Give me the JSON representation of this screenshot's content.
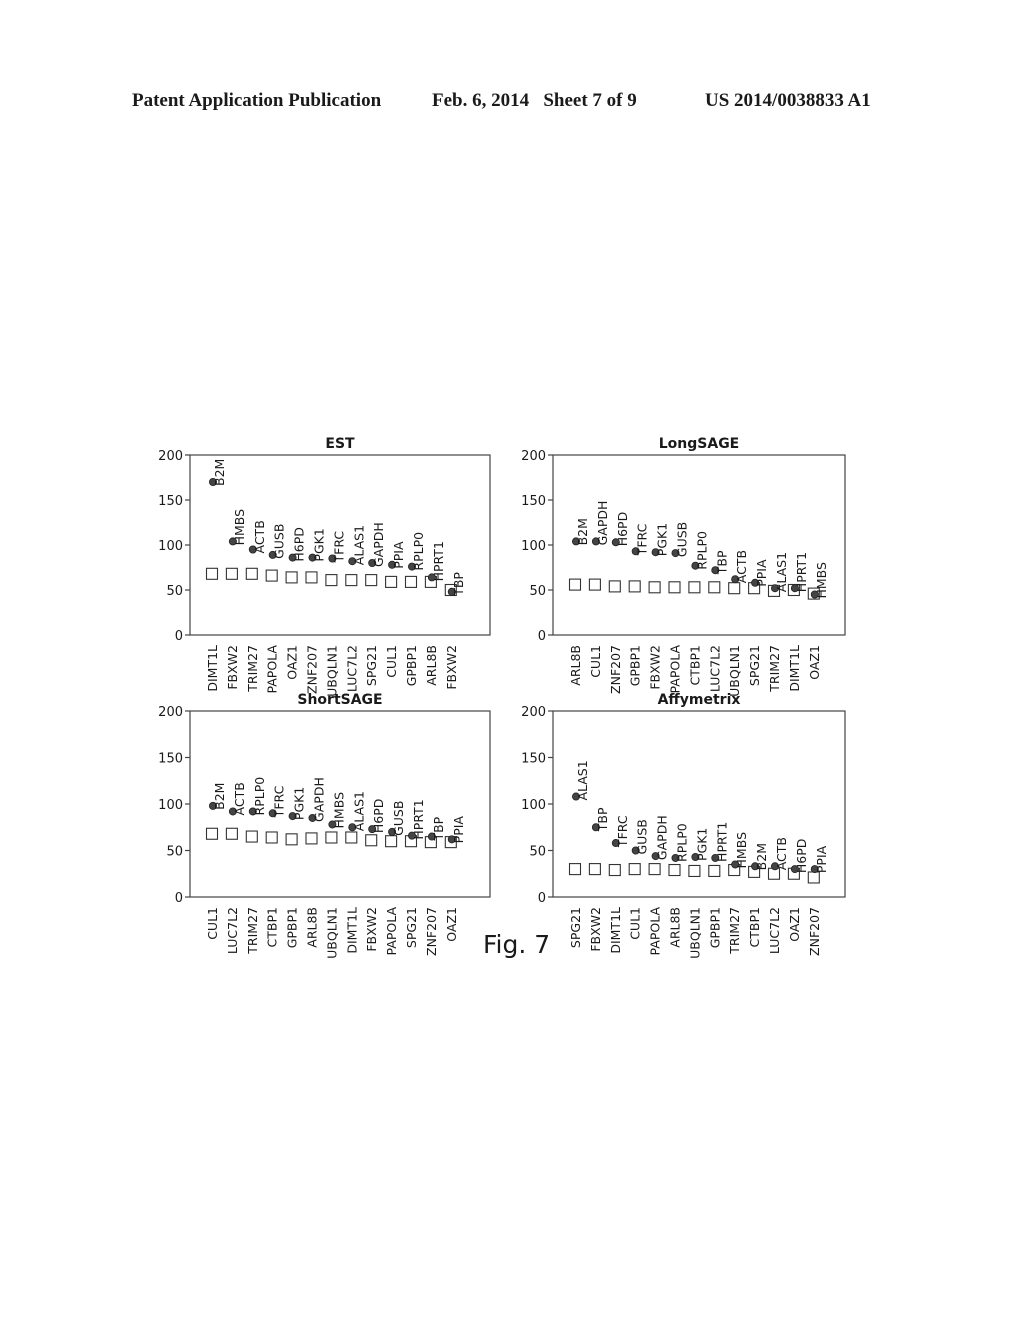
{
  "header": {
    "left": "Patent Application Publication",
    "middle": "Feb. 6, 2014   Sheet 7 of 9",
    "right": "US 2014/0038833 A1"
  },
  "figure_label": "Fig. 7",
  "chart_data": [
    {
      "type": "scatter",
      "title": "EST",
      "ylim": [
        0,
        200
      ],
      "yticks": [
        0,
        50,
        100,
        150,
        200
      ],
      "categories": [
        "DIMT1L",
        "FBXW2",
        "TRIM27",
        "PAPOLA",
        "OAZ1",
        "ZNF207",
        "UBQLN1",
        "LUC7L2",
        "SPG21",
        "CUL1",
        "GPBP1",
        "ARL8B",
        "FBXW2"
      ],
      "series": [
        {
          "name": "open-square",
          "values": [
            68,
            68,
            68,
            66,
            64,
            64,
            61,
            61,
            61,
            59,
            59,
            59,
            50
          ]
        },
        {
          "name": "filled-circle",
          "labels": [
            "B2M",
            "HMBS",
            "ACTB",
            "GUSB",
            "H6PD",
            "PGK1",
            "TFRC",
            "ALAS1",
            "GAPDH",
            "PPIA",
            "RPLP0",
            "HPRT1",
            "TBP"
          ],
          "values": [
            170,
            104,
            95,
            89,
            86,
            86,
            85,
            82,
            80,
            78,
            76,
            64,
            48
          ]
        }
      ]
    },
    {
      "type": "scatter",
      "title": "LongSAGE",
      "ylim": [
        0,
        200
      ],
      "yticks": [
        0,
        50,
        100,
        150,
        200
      ],
      "categories": [
        "ARL8B",
        "CUL1",
        "ZNF207",
        "GPBP1",
        "FBXW2",
        "PAPOLA",
        "CTBP1",
        "LUC7L2",
        "UBQLN1",
        "SPG21",
        "TRIM27",
        "DIMT1L",
        "OAZ1"
      ],
      "series": [
        {
          "name": "open-square",
          "values": [
            56,
            56,
            54,
            54,
            53,
            53,
            53,
            53,
            52,
            52,
            49,
            50,
            46
          ]
        },
        {
          "name": "filled-circle",
          "labels": [
            "B2M",
            "GAPDH",
            "H6PD",
            "TFRC",
            "PGK1",
            "GUSB",
            "RPLP0",
            "TBP",
            "ACTB",
            "PPIA",
            "ALAS1",
            "HPRT1",
            "HMBS"
          ],
          "values": [
            104,
            104,
            103,
            93,
            92,
            91,
            77,
            72,
            62,
            58,
            52,
            52,
            45
          ]
        }
      ]
    },
    {
      "type": "scatter",
      "title": "ShortSAGE",
      "ylim": [
        0,
        200
      ],
      "yticks": [
        0,
        50,
        100,
        150,
        200
      ],
      "categories": [
        "CUL1",
        "LUC7L2",
        "TRIM27",
        "CTBP1",
        "GPBP1",
        "ARL8B",
        "UBQLN1",
        "DIMT1L",
        "FBXW2",
        "PAPOLA",
        "SPG21",
        "ZNF207",
        "OAZ1"
      ],
      "series": [
        {
          "name": "open-square",
          "values": [
            68,
            68,
            65,
            64,
            62,
            63,
            64,
            64,
            61,
            60,
            60,
            59,
            59
          ]
        },
        {
          "name": "filled-circle",
          "labels": [
            "B2M",
            "ACTB",
            "RPLP0",
            "TFRC",
            "PGK1",
            "GAPDH",
            "HMBS",
            "ALAS1",
            "H6PD",
            "GUSB",
            "HPRT1",
            "TBP",
            "PPIA"
          ],
          "values": [
            98,
            92,
            92,
            90,
            87,
            85,
            78,
            75,
            73,
            70,
            66,
            65,
            62
          ]
        }
      ]
    },
    {
      "type": "scatter",
      "title": "Affymetrix",
      "ylim": [
        0,
        200
      ],
      "yticks": [
        0,
        50,
        100,
        150,
        200
      ],
      "categories": [
        "SPG21",
        "FBXW2",
        "DIMT1L",
        "CUL1",
        "PAPOLA",
        "ARL8B",
        "UBQLN1",
        "GPBP1",
        "TRIM27",
        "CTBP1",
        "LUC7L2",
        "OAZ1",
        "ZNF207"
      ],
      "series": [
        {
          "name": "open-square",
          "values": [
            30,
            30,
            29,
            30,
            30,
            29,
            28,
            28,
            29,
            27,
            25,
            25,
            21
          ]
        },
        {
          "name": "filled-circle",
          "labels": [
            "ALAS1",
            "TBP",
            "TFRC",
            "GUSB",
            "GAPDH",
            "RPLP0",
            "PGK1",
            "HPRT1",
            "HMBS",
            "B2M",
            "ACTB",
            "H6PD",
            "PPIA"
          ],
          "values": [
            108,
            75,
            58,
            50,
            44,
            42,
            43,
            42,
            35,
            33,
            33,
            30,
            30
          ]
        }
      ]
    }
  ]
}
